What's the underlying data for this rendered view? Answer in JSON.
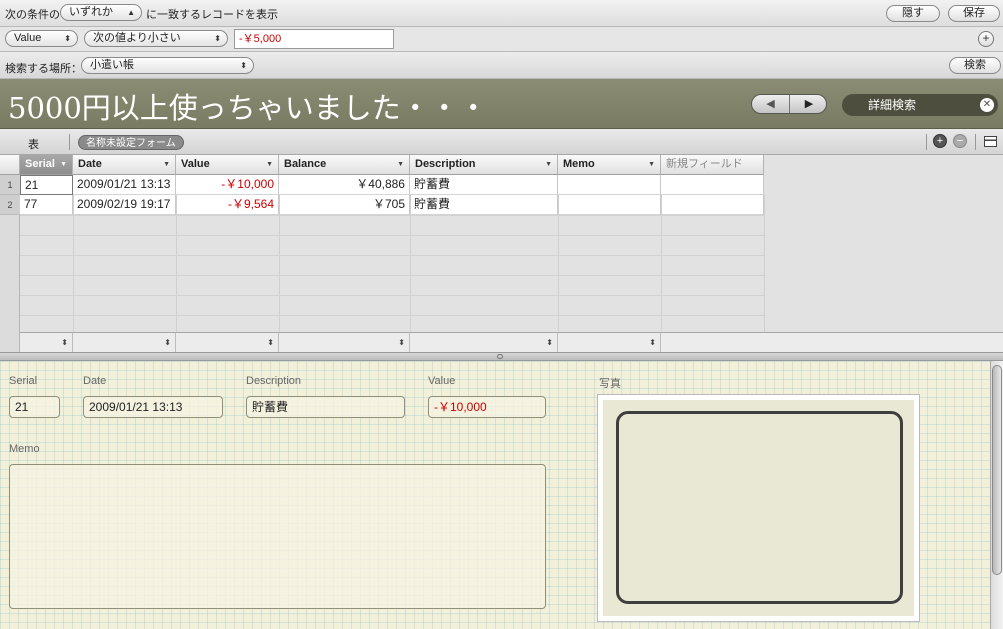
{
  "find": {
    "condition_prefix": "次の条件の",
    "match_popup": "いずれか",
    "condition_suffix": "に一致するレコードを表示",
    "hide_button": "隠す",
    "save_button": "保存",
    "field_popup": "Value",
    "operator_popup": "次の値より小さい",
    "value_input": "-￥5,000",
    "add_rule_icon": "plus-circle-icon",
    "location_label": "検索する場所：",
    "location_popup": "小遣い帳",
    "search_button": "検索"
  },
  "banner": {
    "title": "5000円以上使っちゃいました・・・",
    "prev_icon": "triangle-left-icon",
    "next_icon": "triangle-right-icon",
    "advanced_search": "詳細検索",
    "close_icon": "close-icon"
  },
  "layoutbar": {
    "table_tab": "表",
    "form_name": "名称未設定フォーム",
    "add_icon": "plus-circle-icon",
    "remove_icon": "minus-circle-icon",
    "view_icon": "list-view-icon"
  },
  "table": {
    "columns": [
      "Serial",
      "Date",
      "Value",
      "Balance",
      "Description",
      "Memo",
      "新規フィールド"
    ],
    "rows": [
      {
        "num": "1",
        "serial": "21",
        "date": "2009/01/21 13:13",
        "value": "-￥10,000",
        "balance": "￥40,886",
        "description": "貯蓄費",
        "memo": ""
      },
      {
        "num": "2",
        "serial": "77",
        "date": "2009/02/19 19:17",
        "value": "-￥9,564",
        "balance": "￥705",
        "description": "貯蓄費",
        "memo": ""
      }
    ]
  },
  "form": {
    "serial_label": "Serial",
    "serial_value": "21",
    "date_label": "Date",
    "date_value": "2009/01/21 13:13",
    "description_label": "Description",
    "description_value": "貯蓄費",
    "value_label": "Value",
    "value_value": "-￥10,000",
    "memo_label": "Memo",
    "memo_value": "",
    "photo_label": "写真"
  },
  "colors": {
    "negative": "#cc0000",
    "banner": "#84856d",
    "form_bg": "#f2f0d8"
  }
}
